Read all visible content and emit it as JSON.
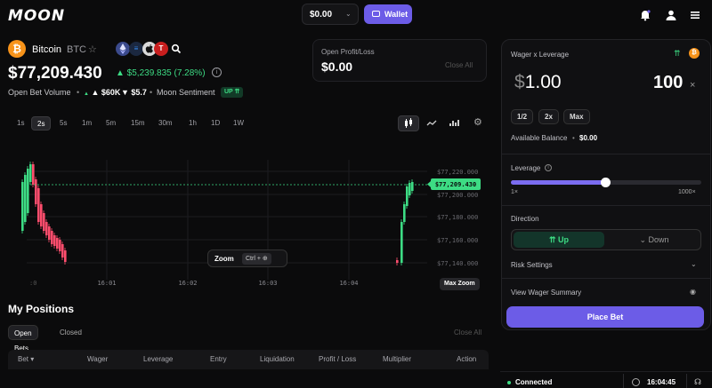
{
  "header": {
    "logo": "MOON",
    "balance": "$0.00",
    "balance_chevron": "⌄",
    "wallet_label": "Wallet",
    "icons": [
      "bell-icon",
      "user-icon",
      "menu-icon"
    ]
  },
  "asset": {
    "name": "Bitcoin",
    "symbol": "BTC",
    "coin_glyph": "₿",
    "tokens": [
      "ETH",
      "≡",
      "",
      "T"
    ],
    "price": "$77,209.430",
    "change": "▲ $5,239.835 (7.28%)",
    "open_bet_volume_label": "Open Bet Volume",
    "volume_up": "▲ $60K",
    "volume_down": "▼ $5.7",
    "moon_sentiment_label": "Moon Sentiment",
    "sentiment_badge": "UP ⇈"
  },
  "timeframes": [
    "1s",
    "2s",
    "5s",
    "1m",
    "5m",
    "15m",
    "30m",
    "1h",
    "1D",
    "1W"
  ],
  "selected_timeframe": "2s",
  "open_pl": {
    "label": "Open Profit/Loss",
    "value": "$0.00",
    "close_all": "Close All"
  },
  "chart_data": {
    "type": "candlestick",
    "x_ticks": [
      "16:01",
      "16:02",
      "16:03",
      "16:04"
    ],
    "x_start_partial": ":0",
    "y_ticks": [
      "$77,220.000",
      "$77,200.000",
      "$77,180.000",
      "$77,160.000",
      "$77,140.000"
    ],
    "current_price_label": "$77,209.430",
    "colors": {
      "up": "#3ddc84",
      "down": "#ff4d6d",
      "grid": "#1c1c20"
    }
  },
  "zoom": {
    "label": "Zoom",
    "shortcut": "Ctrl + ⊕",
    "max_zoom": "Max Zoom"
  },
  "positions": {
    "title": "My Positions",
    "tabs": [
      "Open Bets",
      "Closed"
    ],
    "close_all": "Close All",
    "columns": [
      "Bet ▾",
      "Wager",
      "Leverage",
      "Entry",
      "Liquidation",
      "Profit / Loss",
      "Multiplier",
      "Action"
    ]
  },
  "bet_panel": {
    "title": "Wager x Leverage",
    "wager_symbol": "$",
    "wager_value": "1.00",
    "leverage_value": "100",
    "leverage_unit": "×",
    "quick": [
      "1/2",
      "2x",
      "Max"
    ],
    "available_balance_label": "Available Balance",
    "available_balance_dot": "•",
    "available_balance": "$0.00",
    "leverage_label": "Leverage",
    "leverage_info": "i",
    "slider_fraction": 0.495,
    "slider_min": "1×",
    "slider_max": "1000×",
    "direction_label": "Direction",
    "up": "⇈ Up",
    "down": "⌄ Down",
    "risk_settings": "Risk Settings",
    "view_summary": "View Wager Summary",
    "place_bet": "Place Bet"
  },
  "footer": {
    "connected": "Connected",
    "clock": "16:04:45"
  },
  "accent": "#6c5ce7"
}
